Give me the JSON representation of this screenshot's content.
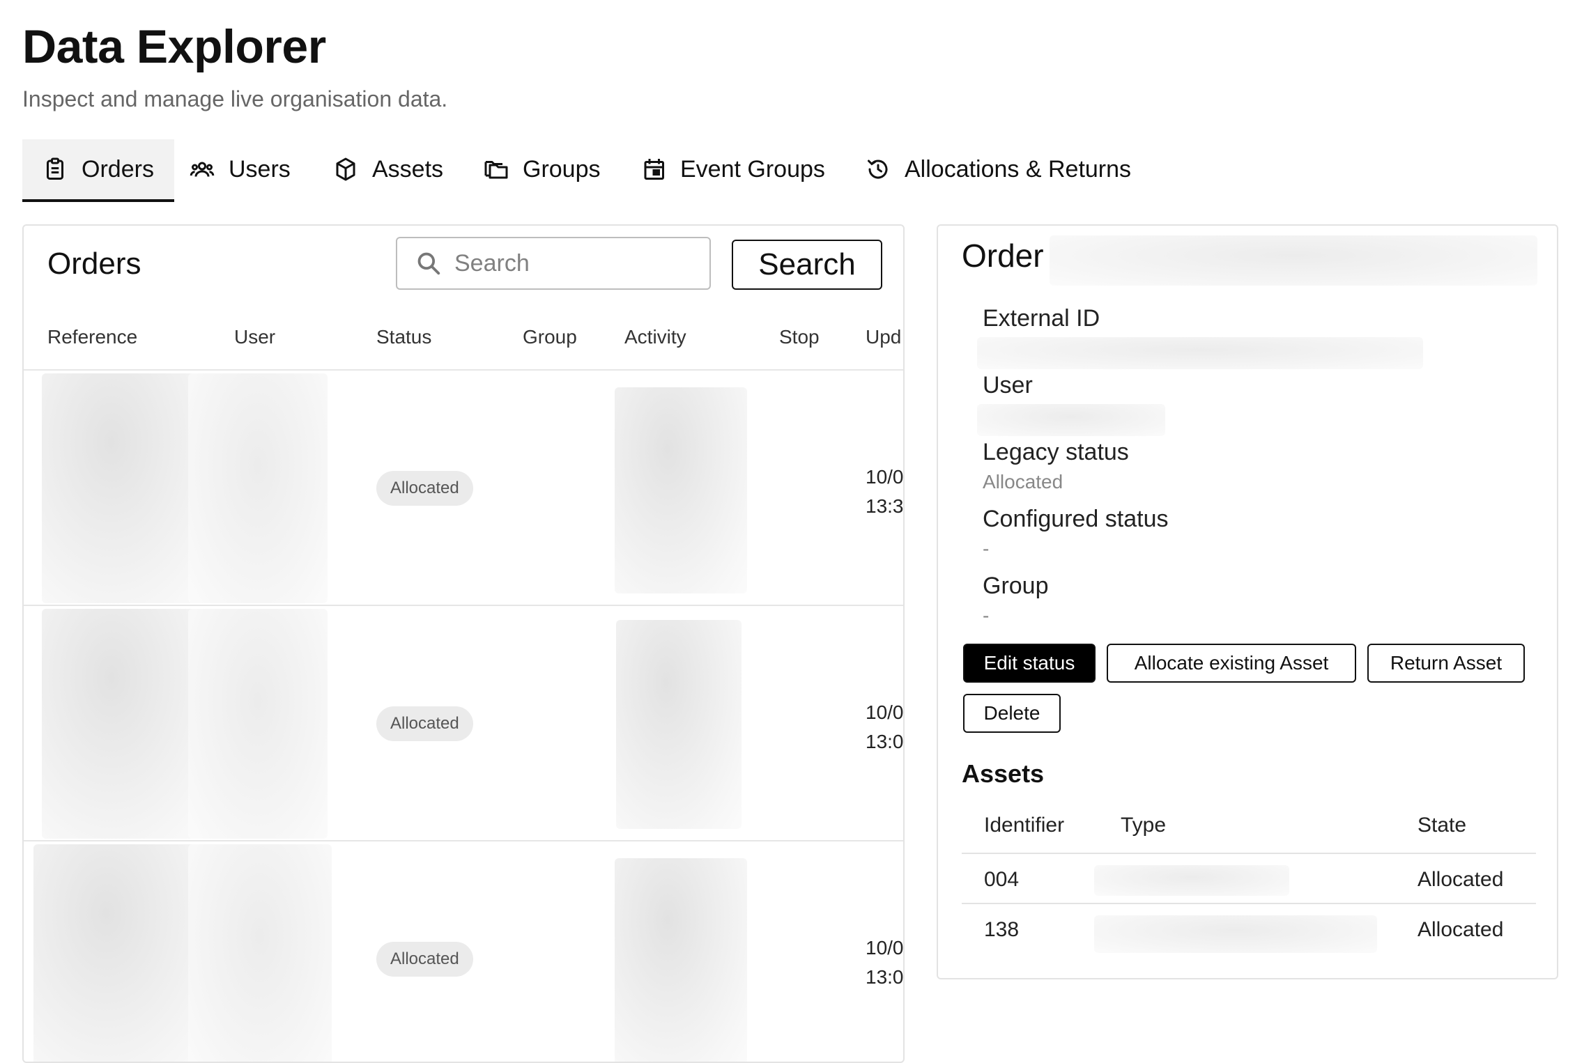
{
  "page": {
    "title": "Data Explorer",
    "subtitle": "Inspect and manage live organisation data."
  },
  "tabs": [
    {
      "label": "Orders",
      "icon": "clipboard-icon",
      "active": true
    },
    {
      "label": "Users",
      "icon": "users-icon",
      "active": false
    },
    {
      "label": "Assets",
      "icon": "cube-icon",
      "active": false
    },
    {
      "label": "Groups",
      "icon": "folders-icon",
      "active": false
    },
    {
      "label": "Event Groups",
      "icon": "calendar-icon",
      "active": false
    },
    {
      "label": "Allocations & Returns",
      "icon": "history-icon",
      "active": false
    }
  ],
  "orders": {
    "heading": "Orders",
    "search_placeholder": "Search",
    "search_button": "Search",
    "columns": [
      "Reference",
      "User",
      "Status",
      "Group",
      "Activity",
      "Stop",
      "Upd"
    ],
    "rows": [
      {
        "status": "Allocated",
        "updated_line1": "10/0",
        "updated_line2": "13:3"
      },
      {
        "status": "Allocated",
        "updated_line1": "10/0",
        "updated_line2": "13:0"
      },
      {
        "status": "Allocated",
        "updated_line1": "10/0",
        "updated_line2": "13:0"
      }
    ]
  },
  "detail": {
    "title": "Order",
    "fields": {
      "external_id_label": "External ID",
      "user_label": "User",
      "legacy_status_label": "Legacy status",
      "legacy_status_value": "Allocated",
      "configured_status_label": "Configured status",
      "configured_status_value": "-",
      "group_label": "Group",
      "group_value": "-"
    },
    "buttons": {
      "edit_status": "Edit status",
      "allocate": "Allocate existing Asset",
      "return": "Return Asset",
      "delete": "Delete"
    },
    "assets": {
      "heading": "Assets",
      "columns": [
        "Identifier",
        "Type",
        "State"
      ],
      "rows": [
        {
          "identifier": "004",
          "state": "Allocated"
        },
        {
          "identifier": "138",
          "state": "Allocated"
        }
      ]
    }
  },
  "colors": {
    "accent": "#000000",
    "pill_bg": "#ebebeb",
    "border": "#e3e3e3",
    "muted_text": "#888888"
  }
}
